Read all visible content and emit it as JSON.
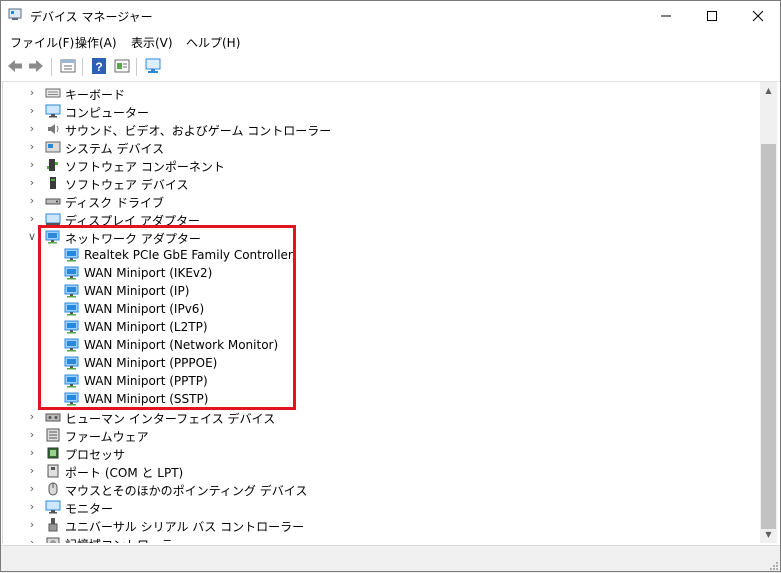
{
  "window": {
    "title": "デバイス マネージャー",
    "minimize_icon": "minimize-icon",
    "maximize_icon": "maximize-icon",
    "close_icon": "close-icon"
  },
  "menu": {
    "items": [
      "ファイル(F)",
      "操作(A)",
      "表示(V)",
      "ヘルプ(H)"
    ]
  },
  "toolbar": {
    "icons": [
      "back-arrow-icon",
      "forward-arrow-icon",
      "properties-icon",
      "help-icon",
      "action-view-icon",
      "monitor-scan-icon"
    ]
  },
  "tree": {
    "items_before": [
      {
        "label": "キーボード",
        "icon": "keyboard-icon"
      },
      {
        "label": "コンピューター",
        "icon": "computer-icon"
      },
      {
        "label": "サウンド、ビデオ、およびゲーム コントローラー",
        "icon": "speaker-icon"
      },
      {
        "label": "システム デバイス",
        "icon": "system-device-icon"
      },
      {
        "label": "ソフトウェア コンポーネント",
        "icon": "software-component-icon"
      },
      {
        "label": "ソフトウェア デバイス",
        "icon": "software-device-icon"
      },
      {
        "label": "ディスク ドライブ",
        "icon": "disk-drive-icon"
      },
      {
        "label": "ディスプレイ アダプター",
        "icon": "display-adapter-icon"
      }
    ],
    "expanded": {
      "label": "ネットワーク アダプター",
      "icon": "network-adapter-icon",
      "children": [
        "Realtek PCIe GbE Family Controller",
        "WAN Miniport (IKEv2)",
        "WAN Miniport (IP)",
        "WAN Miniport (IPv6)",
        "WAN Miniport (L2TP)",
        "WAN Miniport (Network Monitor)",
        "WAN Miniport (PPPOE)",
        "WAN Miniport (PPTP)",
        "WAN Miniport (SSTP)"
      ]
    },
    "items_after": [
      {
        "label": "ヒューマン インターフェイス デバイス",
        "icon": "hid-icon"
      },
      {
        "label": "ファームウェア",
        "icon": "firmware-icon"
      },
      {
        "label": "プロセッサ",
        "icon": "processor-icon"
      },
      {
        "label": "ポート (COM と LPT)",
        "icon": "port-icon"
      },
      {
        "label": "マウスとそのほかのポインティング デバイス",
        "icon": "mouse-icon"
      },
      {
        "label": "モニター",
        "icon": "monitor-icon"
      },
      {
        "label": "ユニバーサル シリアル バス コントローラー",
        "icon": "usb-icon"
      },
      {
        "label": "記憶域コントローラー",
        "icon": "storage-controller-icon"
      }
    ]
  },
  "colors": {
    "highlight_border": "#e3141f",
    "network_icon": "#2b88d8",
    "scroll_thumb": "#c2c2c2"
  }
}
